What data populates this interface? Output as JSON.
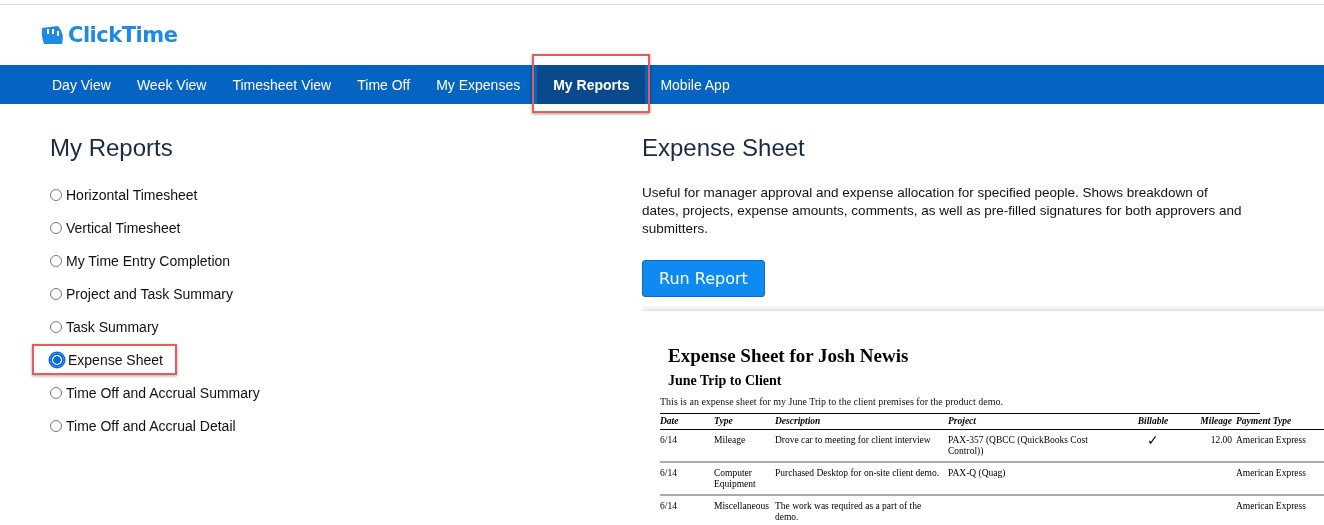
{
  "logo": {
    "text": "ClickTime"
  },
  "nav": [
    {
      "label": "Day View",
      "selected": false,
      "highlighted": false
    },
    {
      "label": "Week View",
      "selected": false,
      "highlighted": false
    },
    {
      "label": "Timesheet View",
      "selected": false,
      "highlighted": false
    },
    {
      "label": "Time Off",
      "selected": false,
      "highlighted": false
    },
    {
      "label": "My Expenses",
      "selected": false,
      "highlighted": false
    },
    {
      "label": "My Reports",
      "selected": true,
      "highlighted": true
    },
    {
      "label": "Mobile App",
      "selected": false,
      "highlighted": false
    }
  ],
  "reports": {
    "title": "My Reports",
    "items": [
      {
        "label": "Horizontal Timesheet",
        "selected": false,
        "highlighted": false
      },
      {
        "label": "Vertical Timesheet",
        "selected": false,
        "highlighted": false
      },
      {
        "label": "My Time Entry Completion",
        "selected": false,
        "highlighted": false
      },
      {
        "label": "Project and Task Summary",
        "selected": false,
        "highlighted": false
      },
      {
        "label": "Task Summary",
        "selected": false,
        "highlighted": false
      },
      {
        "label": "Expense Sheet",
        "selected": true,
        "highlighted": true
      },
      {
        "label": "Time Off and Accrual Summary",
        "selected": false,
        "highlighted": false
      },
      {
        "label": "Time Off and Accrual Detail",
        "selected": false,
        "highlighted": false
      }
    ]
  },
  "detail": {
    "title": "Expense Sheet",
    "description": "Useful for manager approval and expense allocation for specified people. Shows breakdown of dates, projects, expense amounts, comments, as well as pre-filled signatures for both approvers and submitters.",
    "button": "Run Report"
  },
  "preview": {
    "title": "Expense Sheet for Josh Newis",
    "subtitle": "June Trip to Client",
    "note": "This is an expense sheet for my June Trip to the client premises for the product demo.",
    "columns": [
      "Date",
      "Type",
      "Description",
      "Project",
      "Billable",
      "Mileage",
      "Payment Type"
    ],
    "rows": [
      [
        "6/14",
        "Mileage",
        "Drove car to meeting for client interview",
        "PAX-357 (QBCC (QuickBooks Cost Control))",
        "✓",
        "12.00",
        "American Express"
      ],
      [
        "6/14",
        "Computer Equipment",
        "Purchased Desktop for on-site client demo.",
        "PAX-Q (Quag)",
        "",
        "",
        "American Express"
      ],
      [
        "6/14",
        "Miscellaneous",
        "The work was required as a part of the demo.",
        "",
        "",
        "",
        "American Express"
      ]
    ]
  }
}
